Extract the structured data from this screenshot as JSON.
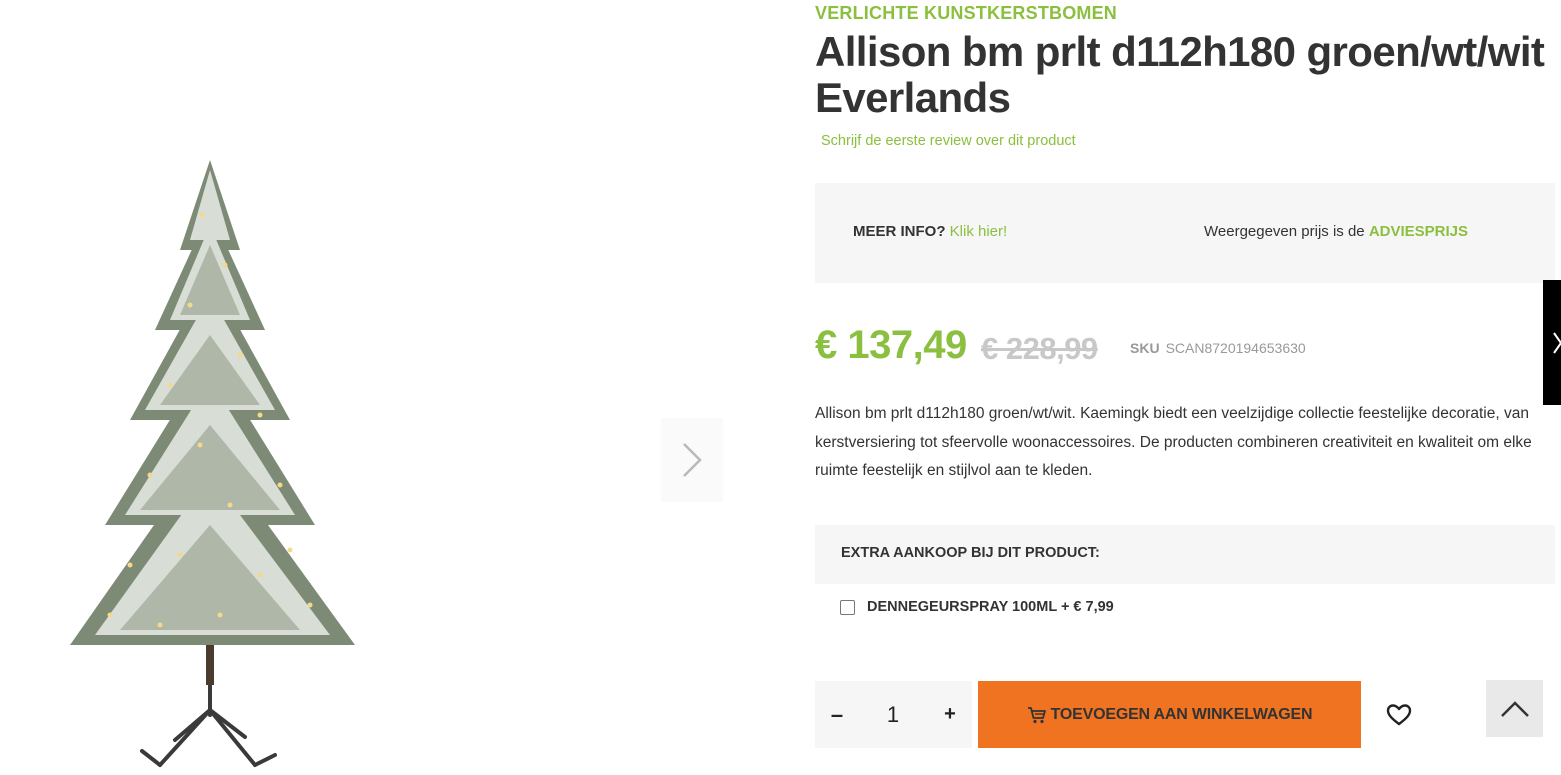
{
  "breadcrumb_category": "VERLICHTE KUNSTKERSTBOMEN",
  "product": {
    "title": "Allison bm prlt d112h180 groen/wt/wit Everlands",
    "review_link": "Schrijf de eerste review over dit product",
    "price_current": "€ 137,49",
    "price_old": "€ 228,99",
    "sku_label": "SKU",
    "sku_value": "SCAN8720194653630",
    "description": "Allison bm prlt d112h180 groen/wt/wit. Kaemingk biedt een veelzijdige collectie feestelijke decoratie, van kerstversiering tot sfeervolle woonaccessoires. De producten combineren creativiteit en kwaliteit om elke ruimte feestelijk en stijlvol aan te kleden."
  },
  "info": {
    "meer_info_label": "MEER INFO?",
    "meer_info_link": "Klik hier!",
    "price_note_prefix": "Weergegeven prijs is de",
    "price_note_strong": "ADVIESPRIJS"
  },
  "extra": {
    "title": "EXTRA AANKOOP BIJ DIT PRODUCT:",
    "option_label": "DENNEGEURSPRAY 100ML + € 7,99",
    "option_checked": false
  },
  "purchase": {
    "minus": "–",
    "quantity": "1",
    "plus": "+",
    "add_to_cart_label": "TOEVOEGEN AAN WINKELWAGEN"
  },
  "icons": {
    "gallery_next": "chevron-right-icon",
    "cart": "cart-icon",
    "wishlist": "heart-icon",
    "scroll_top": "chevron-up-icon",
    "side_tab": "chevron-right-icon"
  },
  "colors": {
    "accent_green": "#8bbf3f",
    "cta_orange": "#f07322",
    "panel_gray": "#f6f6f6",
    "old_price_gray": "#c8c8c8"
  }
}
